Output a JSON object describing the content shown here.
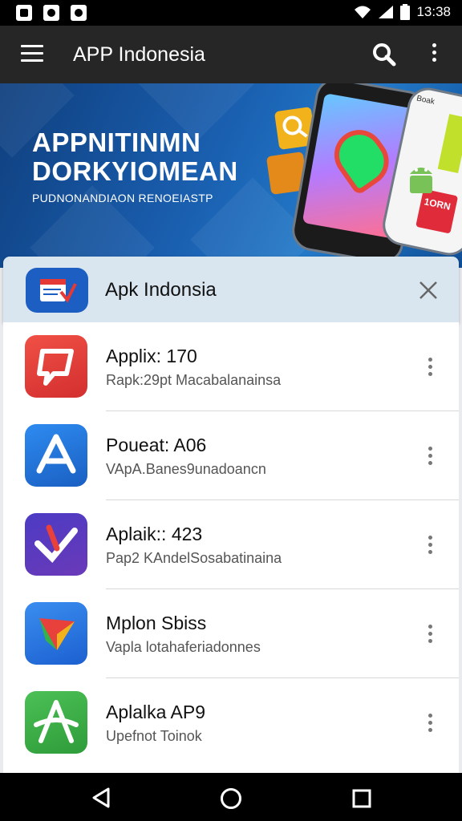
{
  "status_bar": {
    "time": "13:38",
    "icons": [
      "gallery-icon",
      "camera-icon",
      "notification-icon",
      "wifi-icon",
      "signal-icon",
      "battery-icon"
    ]
  },
  "app_bar": {
    "title": "APP Indonesia",
    "icons": [
      "menu-icon",
      "search-icon",
      "overflow-menu-icon"
    ]
  },
  "banner": {
    "headline_line1": "APPNITINMN",
    "headline_line2": "DORKYIOMEAN",
    "subline": "PUDNONANDIAON RENOEIASTP",
    "tile_text_1": "1ORN",
    "tile_text_2": "Boak"
  },
  "card": {
    "title": "Apk Indonsia",
    "icon": "calendar-check-icon"
  },
  "apps": [
    {
      "title": "Applix: 170",
      "subtitle": "Rapk:29pt  Macabalanainsa",
      "color": "#e53935"
    },
    {
      "title": "Poueat: A06",
      "subtitle": "VApA.Banes9unadoancn",
      "color": "#1e73d8"
    },
    {
      "title": "Aplaik:: 423",
      "subtitle": "Pap2 KAndelSosabatinaina",
      "color": "#5036b8"
    },
    {
      "title": "Mplon Sbiss",
      "subtitle": "Vapla lotahaferiadonnes",
      "color": "#2a6fe0"
    },
    {
      "title": "Aplalka AP9",
      "subtitle": "Upefnot Toinok",
      "color": "#3fb34a"
    }
  ],
  "nav": {
    "icons": [
      "back-icon",
      "home-icon",
      "recents-icon"
    ]
  },
  "colors": {
    "status_bar": "#000000",
    "app_bar": "#262626",
    "banner": "#1a5fb0",
    "card_head": "#d9e6ef"
  }
}
